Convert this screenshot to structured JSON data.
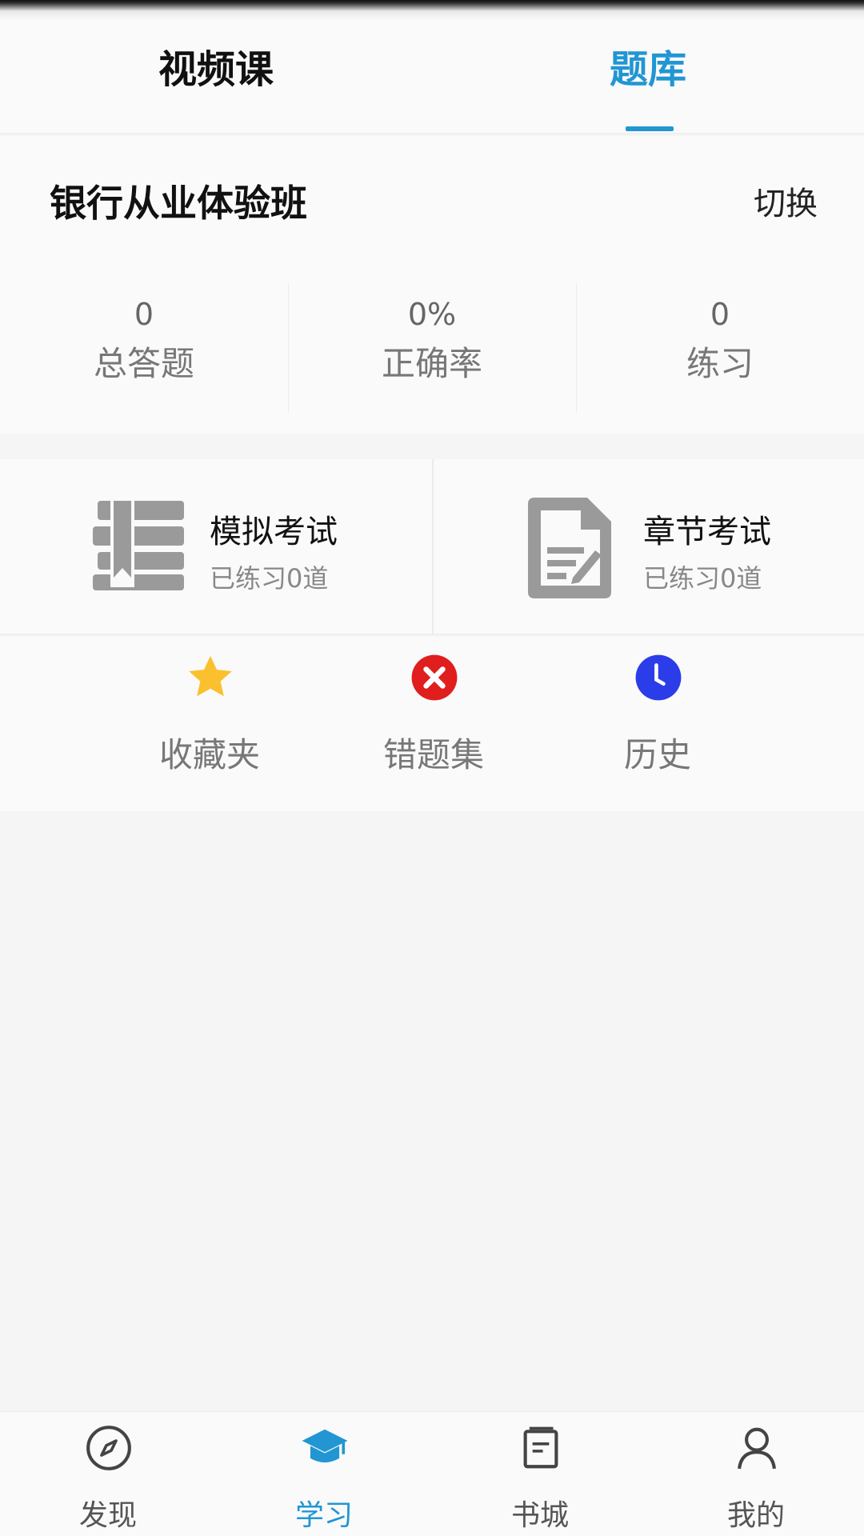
{
  "top_tabs": {
    "video_course": "视频课",
    "question_bank": "题库"
  },
  "active_top_tab": "question_bank",
  "accent_color": "#2196d3",
  "class_info": {
    "title": "银行从业体验班",
    "switch_label": "切换"
  },
  "stats": [
    {
      "value": "0",
      "label": "总答题"
    },
    {
      "value": "0%",
      "label": "正确率"
    },
    {
      "value": "0",
      "label": "练习"
    }
  ],
  "exams": {
    "mock": {
      "title": "模拟考试",
      "subtitle": "已练习0道",
      "icon": "book-list-icon"
    },
    "chapter": {
      "title": "章节考试",
      "subtitle": "已练习0道",
      "icon": "document-edit-icon"
    }
  },
  "tools": [
    {
      "label": "收藏夹",
      "icon": "star-icon",
      "color": "#fbc02d"
    },
    {
      "label": "错题集",
      "icon": "x-circle-icon",
      "color": "#e01e1e"
    },
    {
      "label": "历史",
      "icon": "clock-icon",
      "color": "#2b3de8"
    }
  ],
  "bottom_nav": [
    {
      "label": "发现",
      "icon": "compass-icon"
    },
    {
      "label": "学习",
      "icon": "graduation-cap-icon",
      "active": true
    },
    {
      "label": "书城",
      "icon": "book-icon"
    },
    {
      "label": "我的",
      "icon": "user-icon"
    }
  ]
}
